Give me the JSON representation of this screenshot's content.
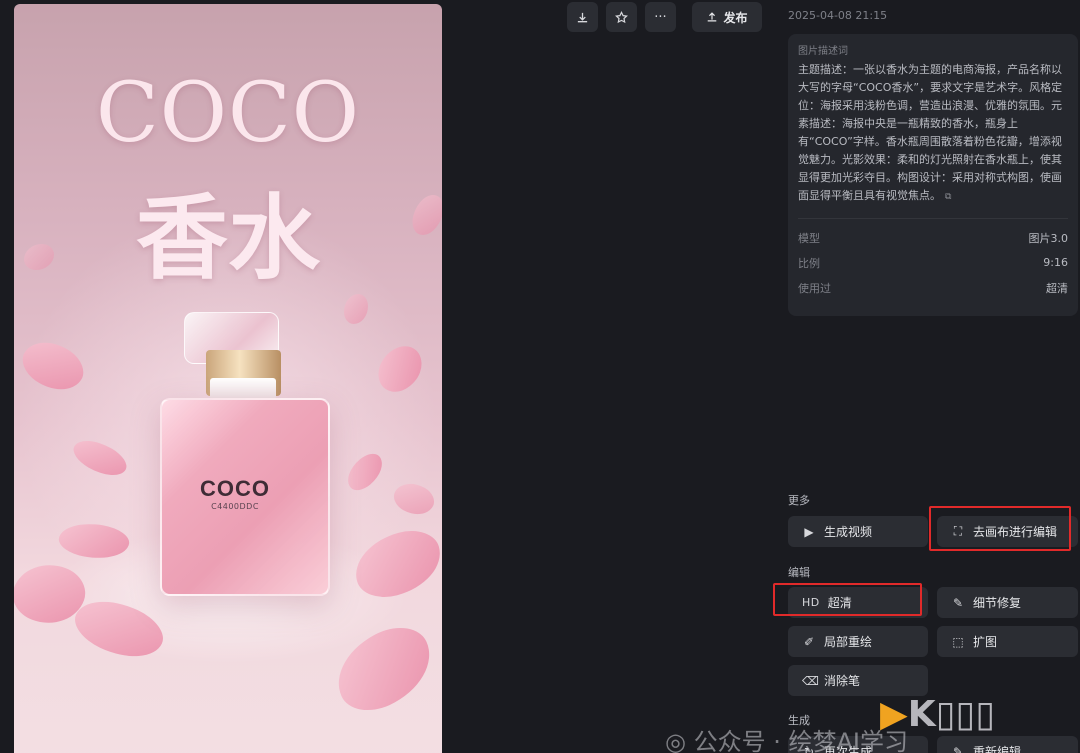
{
  "poster": {
    "title": "COCO",
    "subtitle": "香水",
    "bottle_logo": "COCO",
    "bottle_code": "C4400DDC"
  },
  "toolbar": {
    "download_icon": "download-icon",
    "favorite_icon": "star-icon",
    "more_icon": "ellipsis-icon",
    "publish_label": "发布",
    "publish_icon": "upload-icon"
  },
  "timestamp": "2025-04-08 21:15",
  "description": {
    "heading": "图片描述词",
    "text": "主题描述：一张以香水为主题的电商海报，产品名称以大写的字母“COCO香水”，要求文字是艺术字。风格定位：海报采用浅粉色调，营造出浪漫、优雅的氛围。元素描述：海报中央是一瓶精致的香水，瓶身上有“COCO”字样。香水瓶周围散落着粉色花瓣，增添视觉魅力。光影效果：柔和的灯光照射在香水瓶上，使其显得更加光彩夺目。构图设计：采用对称式构图，使画面显得平衡且具有视觉焦点。"
  },
  "meta": {
    "model_label": "模型",
    "model_value": "图片3.0",
    "ratio_label": "比例",
    "ratio_value": "9:16",
    "used_label": "使用过",
    "used_value": "超清"
  },
  "more": {
    "label": "更多",
    "generate_video": "生成视频",
    "canvas_edit": "去画布进行编辑"
  },
  "edit": {
    "label": "编辑",
    "hd_tag": "HD",
    "upscale": "超清",
    "detail_repair": "细节修复",
    "inpaint": "局部重绘",
    "expand": "扩图",
    "eraser": "消除笔"
  },
  "generate": {
    "label": "生成",
    "regenerate": "再次生成",
    "re_edit": "重新编辑"
  },
  "watermark": {
    "text": "公众号 · 绘梦AI学习"
  },
  "colors": {
    "background": "#1a1b20",
    "panel": "#25272d",
    "button": "#2b2d33",
    "highlight": "#e12a2a"
  }
}
